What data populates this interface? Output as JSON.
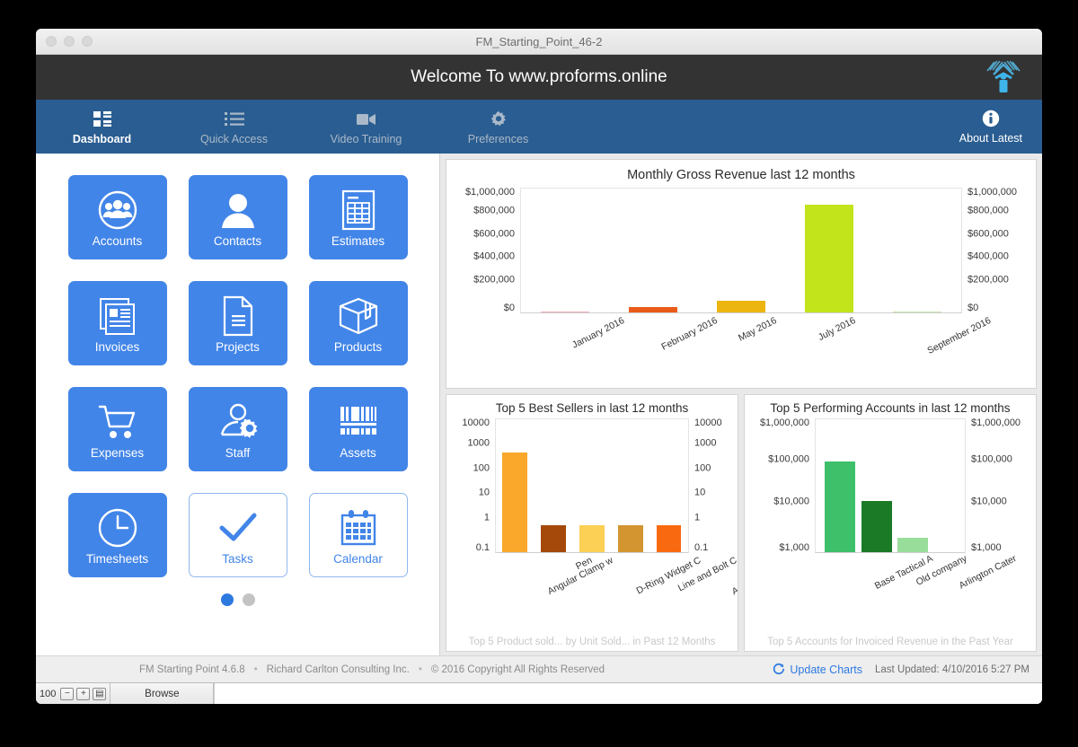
{
  "window": {
    "title": "FM_Starting_Point_46-2",
    "traffic_lights": [
      "close-button",
      "minimize-button",
      "zoom-button"
    ]
  },
  "welcome": {
    "text": "Welcome To www.proforms.online",
    "logo_name": "proforms-logo"
  },
  "nav": {
    "items": [
      {
        "label": "Dashboard",
        "icon": "grid-icon",
        "active": true
      },
      {
        "label": "Quick Access",
        "icon": "list-icon",
        "active": false
      },
      {
        "label": "Video Training",
        "icon": "video-icon",
        "active": false
      },
      {
        "label": "Preferences",
        "icon": "gear-icon",
        "active": false
      }
    ],
    "right": {
      "label": "About Latest",
      "icon": "info-icon"
    }
  },
  "tiles": [
    {
      "label": "Accounts",
      "icon": "people-circle-icon",
      "style": "solid"
    },
    {
      "label": "Contacts",
      "icon": "person-icon",
      "style": "solid"
    },
    {
      "label": "Estimates",
      "icon": "document-table-icon",
      "style": "solid"
    },
    {
      "label": "Invoices",
      "icon": "invoice-stack-icon",
      "style": "solid"
    },
    {
      "label": "Projects",
      "icon": "document-icon",
      "style": "solid"
    },
    {
      "label": "Products",
      "icon": "box-icon",
      "style": "solid"
    },
    {
      "label": "Expenses",
      "icon": "shopping-cart-icon",
      "style": "solid"
    },
    {
      "label": "Staff",
      "icon": "person-gear-icon",
      "style": "solid"
    },
    {
      "label": "Assets",
      "icon": "barcode-icon",
      "style": "solid"
    },
    {
      "label": "Timesheets",
      "icon": "clock-icon",
      "style": "solid"
    },
    {
      "label": "Tasks",
      "icon": "check-icon",
      "style": "light"
    },
    {
      "label": "Calendar",
      "icon": "calendar-icon",
      "style": "light"
    }
  ],
  "pagination": {
    "pages": 2,
    "current": 1
  },
  "chart_data": [
    {
      "type": "bar",
      "id": "monthly-gross-revenue",
      "title": "Monthly Gross Revenue last 12 months",
      "categories": [
        "January 2016",
        "February 2016",
        "May 2016",
        "July 2016",
        "September 2016"
      ],
      "values": [
        8000,
        42000,
        97000,
        870000,
        6000
      ],
      "colors": [
        "#edb0b4",
        "#ea5b19",
        "#edb50f",
        "#c2e41a",
        "#c8e4b0"
      ],
      "ylabel": "",
      "xlabel": "",
      "ylim": [
        0,
        1000000
      ],
      "yticks": [
        0,
        200000,
        400000,
        600000,
        800000,
        1000000
      ],
      "ytick_labels": [
        "$0",
        "$200,000",
        "$400,000",
        "$600,000",
        "$800,000",
        "$1,000,000"
      ],
      "scale": "linear",
      "dual_axis": true,
      "grid": false,
      "legend": "none",
      "footnote": ""
    },
    {
      "type": "bar",
      "id": "top-5-best-sellers",
      "title": "Top 5 Best Sellers in last 12 months",
      "categories": [
        "Angular Clamp w",
        "Pen",
        "D-Ring Widget C",
        "Line and Bolt C",
        "Asymmetrical Mo"
      ],
      "values": [
        700,
        1,
        1,
        1,
        1
      ],
      "colors": [
        "#f9a82b",
        "#a5490b",
        "#fcd055",
        "#d39530",
        "#f96a10"
      ],
      "ylabel": "",
      "xlabel": "",
      "ylim": [
        0.1,
        10000
      ],
      "yticks": [
        0.1,
        1,
        10,
        100,
        1000,
        10000
      ],
      "ytick_labels": [
        "0.1",
        "1",
        "10",
        "100",
        "1000",
        "10000"
      ],
      "scale": "log",
      "dual_axis": true,
      "grid": false,
      "legend": "none",
      "footnote": "Top 5 Product sold... by Unit Sold... in Past 12 Months"
    },
    {
      "type": "bar",
      "id": "top-5-performing-accounts",
      "title": "Top 5 Performing Accounts in last 12 months",
      "categories": [
        "Base Tactical A",
        "Old company",
        "Arlington Cater"
      ],
      "values": [
        115000,
        14500,
        2100
      ],
      "colors": [
        "#3ec06a",
        "#1b7a26",
        "#99dd9b"
      ],
      "ylabel": "",
      "xlabel": "",
      "ylim": [
        1000,
        1000000
      ],
      "yticks": [
        1000,
        10000,
        100000,
        1000000
      ],
      "ytick_labels": [
        "$1,000",
        "$10,000",
        "$100,000",
        "$1,000,000"
      ],
      "scale": "log",
      "dual_axis": true,
      "grid": false,
      "legend": "none",
      "footnote": "Top 5 Accounts for Invoiced Revenue in the Past Year"
    }
  ],
  "footer": {
    "version": "FM Starting Point 4.6.8",
    "company": "Richard Carlton Consulting Inc.",
    "copyright": "© 2016 Copyright All Rights Reserved",
    "separator": "•",
    "update_label": "Update Charts",
    "update_icon": "refresh-icon",
    "last_updated": "Last Updated: 4/10/2016 5:27 PM"
  },
  "statusbar": {
    "zoom_value": "100",
    "zoom_out_icon": "zoom-out-icon",
    "zoom_in_icon": "zoom-in-icon",
    "toggle_icon": "window-toggle-icon",
    "mode": "Browse"
  },
  "colors": {
    "accent_blue": "#4285e8",
    "nav_blue": "#2a5d91",
    "header_dark": "#333333",
    "link_blue": "#2d79e0"
  }
}
